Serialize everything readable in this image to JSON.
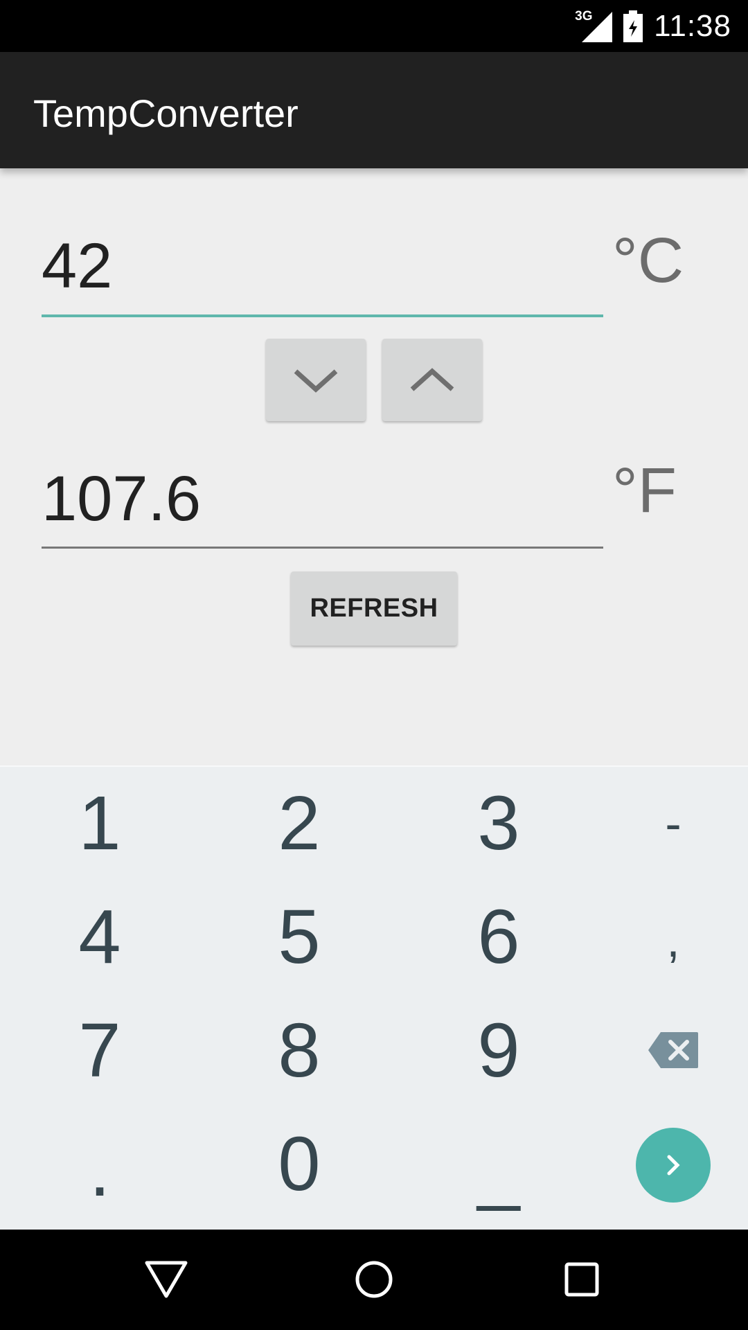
{
  "status_bar": {
    "network": "3G",
    "time": "11:38",
    "icons": [
      "signal-icon",
      "battery-charging-icon"
    ]
  },
  "app_bar": {
    "title": "TempConverter"
  },
  "celsius": {
    "value": "42",
    "unit": "°C"
  },
  "fahrenheit": {
    "value": "107.6",
    "unit": "°F"
  },
  "stepper": {
    "down_icon": "chevron-down-icon",
    "up_icon": "chevron-up-icon"
  },
  "refresh_button": {
    "label": "REFRESH"
  },
  "keyboard": {
    "rows": [
      [
        "1",
        "2",
        "3",
        "-"
      ],
      [
        "4",
        "5",
        "6",
        ","
      ],
      [
        "7",
        "8",
        "9",
        "backspace"
      ],
      [
        ".",
        "0",
        "_",
        "go"
      ]
    ],
    "backspace_icon": "backspace-icon",
    "go_icon": "chevron-right-icon"
  },
  "nav_bar": {
    "icons": [
      "back-icon",
      "home-icon",
      "recents-icon"
    ]
  },
  "colors": {
    "accent": "#4db6ac",
    "app_bar": "#212121",
    "background": "#eeeeee",
    "keyboard": "#eceff1"
  }
}
